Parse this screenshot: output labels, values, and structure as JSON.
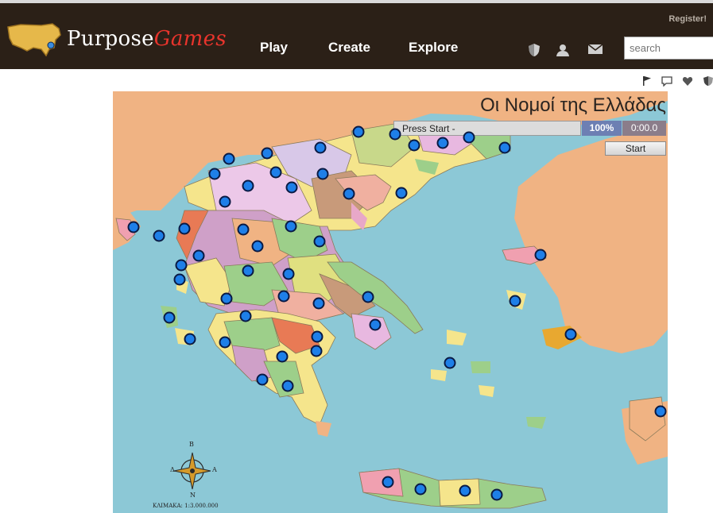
{
  "header": {
    "logo_main": "Purpose",
    "logo_accent": "Games",
    "nav": [
      "Play",
      "Create",
      "Explore"
    ],
    "register": "Register!",
    "search_placeholder": "search",
    "icons": [
      "shield-icon",
      "user-icon",
      "mail-icon"
    ]
  },
  "toolbar_icons": [
    "flag-icon",
    "comment-icon",
    "heart-icon",
    "shield-icon"
  ],
  "game": {
    "title": "Οι Νομοί της Ελλάδας",
    "status": "Press Start -",
    "percent": "100%",
    "timer": "0:00.0",
    "start_label": "Start",
    "scale_text": "ΚΛΙΜΑΚΑ: 1:3.000.000",
    "compass_letters": [
      "Β",
      "Δ",
      "Α",
      "Ν"
    ]
  },
  "colors": {
    "header_bg": "#2b2017",
    "sea": "#8cc8d6",
    "land_foreign": "#f0b383",
    "dot": "#1e7fe8"
  }
}
